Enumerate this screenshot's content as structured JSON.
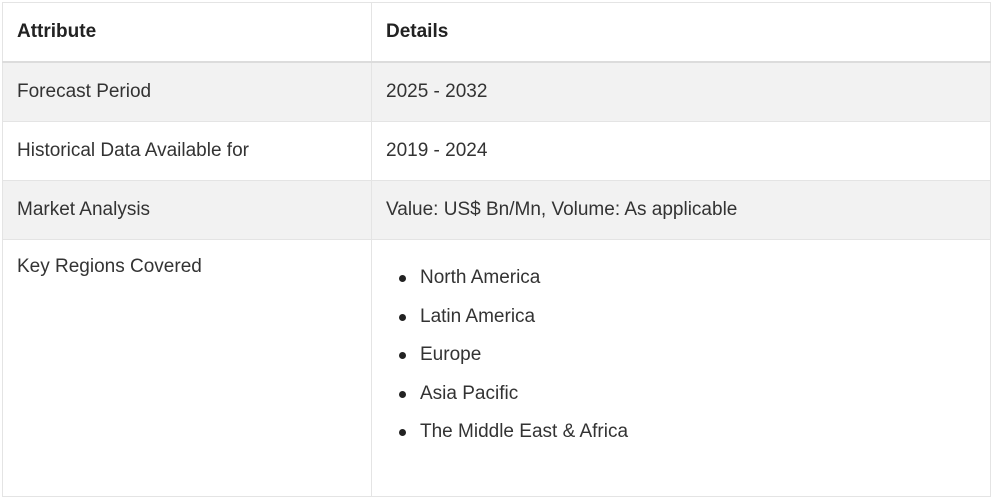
{
  "table": {
    "headers": [
      "Attribute",
      "Details"
    ],
    "rows": [
      {
        "attribute": "Forecast Period",
        "details": "2025 - 2032"
      },
      {
        "attribute": "Historical Data Available for",
        "details": "2019 - 2024"
      },
      {
        "attribute": "Market Analysis",
        "details": "Value: US$ Bn/Mn, Volume: As applicable"
      }
    ],
    "regions_row": {
      "attribute": "Key Regions Covered",
      "regions": [
        "North America",
        "Latin America",
        "Europe",
        "Asia Pacific",
        "The Middle East & Africa"
      ]
    }
  }
}
